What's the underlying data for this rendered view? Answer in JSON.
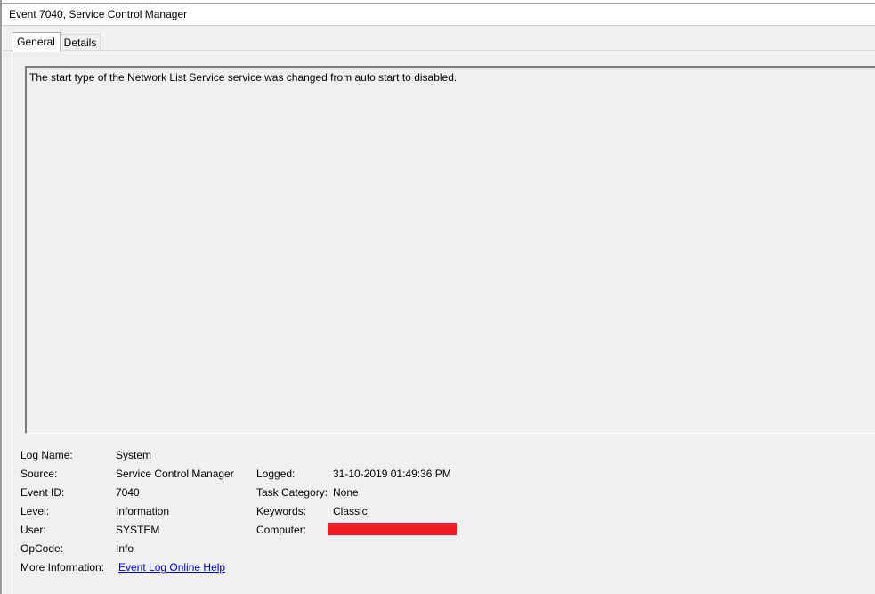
{
  "window": {
    "title": "Event 7040, Service Control Manager"
  },
  "tabs": [
    {
      "label": "General",
      "active": true
    },
    {
      "label": "Details",
      "active": false
    }
  ],
  "description": "The start type of the Network List Service service was changed from auto start to disabled.",
  "fields": {
    "log_name": {
      "label": "Log Name:",
      "value": "System"
    },
    "source": {
      "label": "Source:",
      "value": "Service Control Manager"
    },
    "event_id": {
      "label": "Event ID:",
      "value": "7040"
    },
    "level": {
      "label": "Level:",
      "value": "Information"
    },
    "user": {
      "label": "User:",
      "value": "SYSTEM"
    },
    "opcode": {
      "label": "OpCode:",
      "value": "Info"
    },
    "more_info": {
      "label": "More Information:",
      "value": "Event Log Online Help"
    },
    "logged": {
      "label": "Logged:",
      "value": "31-10-2019 01:49:36 PM"
    },
    "task_category": {
      "label": "Task Category:",
      "value": "None"
    },
    "keywords": {
      "label": "Keywords:",
      "value": "Classic"
    },
    "computer": {
      "label": "Computer:",
      "value": ""
    }
  },
  "colors": {
    "panel_bg": "#f0f0f0",
    "link": "#0000cc",
    "redaction": "#ed1c24"
  }
}
